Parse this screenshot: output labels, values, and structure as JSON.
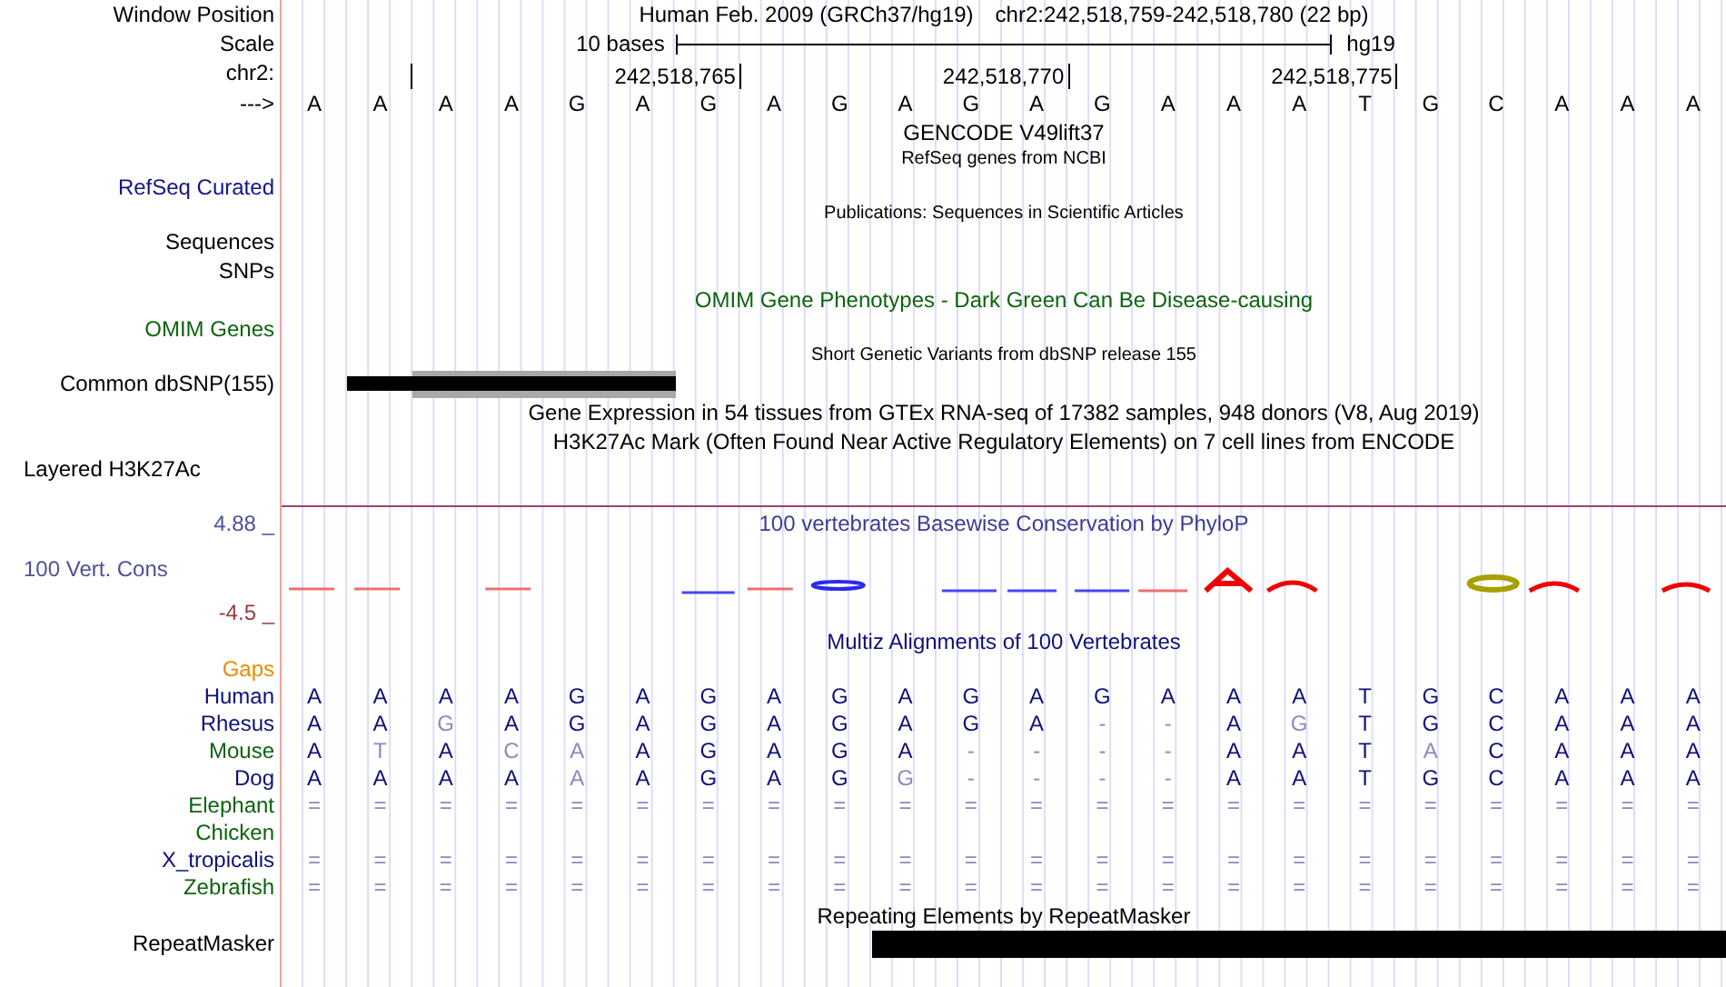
{
  "position": {
    "label": "Window Position",
    "assembly": "Human Feb. 2009 (GRCh37/hg19)",
    "range": "chr2:242,518,759-242,518,780 (22 bp)"
  },
  "scale": {
    "label": "Scale",
    "span": "10 bases",
    "database": "hg19"
  },
  "ruler": {
    "label": "chr2:",
    "ticks": [
      "242,518,765",
      "242,518,770",
      "242,518,775"
    ]
  },
  "sequence": {
    "label": "--->",
    "bases": [
      "A",
      "A",
      "A",
      "A",
      "G",
      "A",
      "G",
      "A",
      "G",
      "A",
      "G",
      "A",
      "G",
      "A",
      "A",
      "A",
      "T",
      "G",
      "C",
      "A",
      "A",
      "A"
    ]
  },
  "tracks": [
    {
      "kind": "plain",
      "title": {
        "text": "GENCODE V49lift37",
        "color": "#000000"
      },
      "minor": false
    },
    {
      "kind": "plain",
      "title": {
        "text": "RefSeq genes from NCBI",
        "color": "#000000"
      },
      "minor": true,
      "labels": [
        "RefSeq Curated"
      ],
      "color": "#14148c"
    },
    {
      "kind": "plain",
      "title": {
        "text": "Publications: Sequences in Scientific Articles",
        "color": "#000000"
      },
      "minor": true,
      "labels": [
        "Sequences",
        "SNPs"
      ],
      "color": "#000000"
    },
    {
      "kind": "plain",
      "title": {
        "text": "OMIM Gene Phenotypes - Dark Green Can Be Disease-causing",
        "color": "#0c640c"
      },
      "minor": false,
      "labels": [
        "OMIM Genes"
      ],
      "color": "#0c640c"
    },
    {
      "kind": "variants",
      "title": {
        "text": "Short Genetic Variants from dbSNP release 155",
        "color": "#000000"
      },
      "minor": true,
      "labels": [
        "Common dbSNP(155)"
      ],
      "color": "#000000"
    },
    {
      "kind": "plain",
      "title": {
        "text": "Gene Expression in 54 tissues from GTEx RNA-seq of 17382 samples, 948 donors (V8, Aug 2019)",
        "color": "#000000"
      },
      "minor": false
    },
    {
      "kind": "layered",
      "title": {
        "text": "H3K27Ac Mark (Often Found Near Active Regulatory Elements) on 7 cell lines from ENCODE",
        "color": "#000000"
      },
      "minor": false,
      "labels": [
        "Layered H3K27Ac"
      ],
      "color": "#000000"
    },
    {
      "kind": "conservation",
      "title": {
        "text": "100 vertebrates Basewise Conservation by PhyloP",
        "color": "#3c3c96"
      },
      "minor": false,
      "labels": [
        "100 Vert. Cons"
      ],
      "color": "#50509c",
      "scale_max": "4.88 _",
      "scale_min": "-4.5 _"
    },
    {
      "kind": "alignment",
      "title": {
        "text": "Multiz Alignments of 100 Vertebrates",
        "color": "#10107a"
      },
      "minor": false,
      "labels": [
        "Gaps"
      ],
      "color": "#e88c00",
      "species": [
        {
          "name": "Human",
          "color": "#10107a",
          "bases": [
            "A",
            "A",
            "A",
            "A",
            "G",
            "A",
            "G",
            "A",
            "G",
            "A",
            "G",
            "A",
            "G",
            "A",
            "A",
            "A",
            "T",
            "G",
            "C",
            "A",
            "A",
            "A"
          ],
          "faded": [
            false,
            false,
            false,
            false,
            false,
            false,
            false,
            false,
            false,
            false,
            false,
            false,
            false,
            false,
            false,
            false,
            false,
            false,
            false,
            false,
            false,
            false
          ]
        },
        {
          "name": "Rhesus",
          "color": "#10107a",
          "bases": [
            "A",
            "A",
            "G",
            "A",
            "G",
            "A",
            "G",
            "A",
            "G",
            "A",
            "G",
            "A",
            "-",
            "-",
            "A",
            "G",
            "T",
            "G",
            "C",
            "A",
            "A",
            "A"
          ],
          "faded": [
            false,
            false,
            true,
            false,
            false,
            false,
            false,
            false,
            false,
            false,
            false,
            false,
            true,
            true,
            false,
            true,
            false,
            false,
            false,
            false,
            false,
            false
          ]
        },
        {
          "name": "Mouse",
          "color": "#0c640c",
          "bases": [
            "A",
            "T",
            "A",
            "C",
            "A",
            "A",
            "G",
            "A",
            "G",
            "A",
            "-",
            "-",
            "-",
            "-",
            "A",
            "A",
            "T",
            "A",
            "C",
            "A",
            "A",
            "A"
          ],
          "faded": [
            false,
            true,
            false,
            true,
            true,
            false,
            false,
            false,
            false,
            false,
            true,
            true,
            true,
            true,
            false,
            false,
            false,
            true,
            false,
            false,
            false,
            false
          ]
        },
        {
          "name": "Dog",
          "color": "#10107a",
          "bases": [
            "A",
            "A",
            "A",
            "A",
            "A",
            "A",
            "G",
            "A",
            "G",
            "G",
            "-",
            "-",
            "-",
            "-",
            "A",
            "A",
            "T",
            "G",
            "C",
            "A",
            "A",
            "A"
          ],
          "faded": [
            false,
            false,
            false,
            false,
            true,
            false,
            false,
            false,
            false,
            true,
            true,
            true,
            true,
            true,
            false,
            false,
            false,
            false,
            false,
            false,
            false,
            false
          ]
        },
        {
          "name": "Elephant",
          "color": "#0c640c",
          "bases": [
            "=",
            "=",
            "=",
            "=",
            "=",
            "=",
            "=",
            "=",
            "=",
            "=",
            "=",
            "=",
            "=",
            "=",
            "=",
            "=",
            "=",
            "=",
            "=",
            "=",
            "=",
            "="
          ],
          "faded": [
            true,
            true,
            true,
            true,
            true,
            true,
            true,
            true,
            true,
            true,
            true,
            true,
            true,
            true,
            true,
            true,
            true,
            true,
            true,
            true,
            true,
            true
          ]
        },
        {
          "name": "Chicken",
          "color": "#0c640c"
        },
        {
          "name": "X_tropicalis",
          "color": "#10107a",
          "bases": [
            "=",
            "=",
            "=",
            "=",
            "=",
            "=",
            "=",
            "=",
            "=",
            "=",
            "=",
            "=",
            "=",
            "=",
            "=",
            "=",
            "=",
            "=",
            "=",
            "=",
            "=",
            "="
          ],
          "faded": [
            true,
            true,
            true,
            true,
            true,
            true,
            true,
            true,
            true,
            true,
            true,
            true,
            true,
            true,
            true,
            true,
            true,
            true,
            true,
            true,
            true,
            true
          ]
        },
        {
          "name": "Zebrafish",
          "color": "#0c640c",
          "bases": [
            "=",
            "=",
            "=",
            "=",
            "=",
            "=",
            "=",
            "=",
            "=",
            "=",
            "=",
            "=",
            "=",
            "=",
            "=",
            "=",
            "=",
            "=",
            "=",
            "=",
            "=",
            "="
          ],
          "faded": [
            true,
            true,
            true,
            true,
            true,
            true,
            true,
            true,
            true,
            true,
            true,
            true,
            true,
            true,
            true,
            true,
            true,
            true,
            true,
            true,
            true,
            true
          ]
        }
      ]
    },
    {
      "kind": "repeats",
      "title": {
        "text": "Repeating Elements by RepeatMasker",
        "color": "#000000"
      },
      "minor": false,
      "labels": [
        "RepeatMasker"
      ],
      "color": "#000000"
    }
  ]
}
